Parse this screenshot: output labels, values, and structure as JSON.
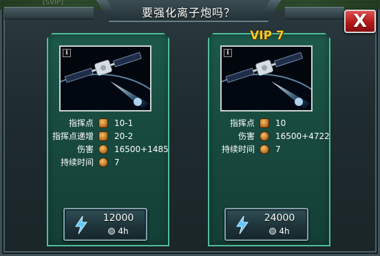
{
  "dialog": {
    "title": "要强化离子炮吗？",
    "background_tag": "[SVIP]",
    "close_label": "X"
  },
  "options": [
    {
      "vip_label": "",
      "info_label": "i",
      "stats": [
        {
          "label": "指挥点",
          "value": "10-1",
          "icon": "command-point-icon"
        },
        {
          "label": "指挥点递增",
          "value": "20-2",
          "icon": "command-increase-icon"
        },
        {
          "label": "伤害",
          "value": "16500+1485",
          "icon": "damage-icon"
        },
        {
          "label": "持续时间",
          "value": "7",
          "icon": "duration-icon"
        }
      ],
      "cost": "12000",
      "time": "4h"
    },
    {
      "vip_label": "VIP 7",
      "info_label": "i",
      "stats": [
        {
          "label": "指挥点",
          "value": "10",
          "icon": "command-point-icon"
        },
        {
          "label": "伤害",
          "value": "16500+4722",
          "icon": "damage-icon"
        },
        {
          "label": "持续时间",
          "value": "7",
          "icon": "duration-icon"
        }
      ],
      "cost": "24000",
      "time": "4h"
    }
  ],
  "colors": {
    "panel_border": "#4fbf9e",
    "vip_gold": "#ffcb1f",
    "close_red": "#b5191b"
  }
}
